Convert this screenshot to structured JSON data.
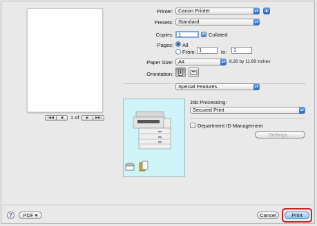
{
  "preview": {
    "page_indicator": "1 of 1"
  },
  "printer": {
    "label": "Printer:",
    "value": "Canon Printer"
  },
  "presets": {
    "label": "Presets:",
    "value": "Standard"
  },
  "copies": {
    "label": "Copies:",
    "value": "1",
    "collated_label": "Collated",
    "collated_checked": true
  },
  "pages": {
    "label": "Pages:",
    "all_label": "All",
    "from_label": "From:",
    "from_value": "1",
    "to_label": "to:",
    "to_value": "1"
  },
  "paper_size": {
    "label": "Paper Size:",
    "value": "A4",
    "dimensions": "8.26 by 11.69 inches"
  },
  "orientation": {
    "label": "Orientation:"
  },
  "section_select": {
    "value": "Special Features"
  },
  "job_processing": {
    "label": "Job Processing:",
    "value": "Secured Print"
  },
  "department": {
    "label": "Department ID Management",
    "settings_label": "Settings..."
  },
  "footer": {
    "help": "?",
    "pdf_label": "PDF ▾",
    "cancel_label": "Cancel",
    "print_label": "Print"
  },
  "colors": {
    "accent": "#3a78d0",
    "highlight": "#cc2020",
    "preview_bg": "#cef4f7"
  }
}
